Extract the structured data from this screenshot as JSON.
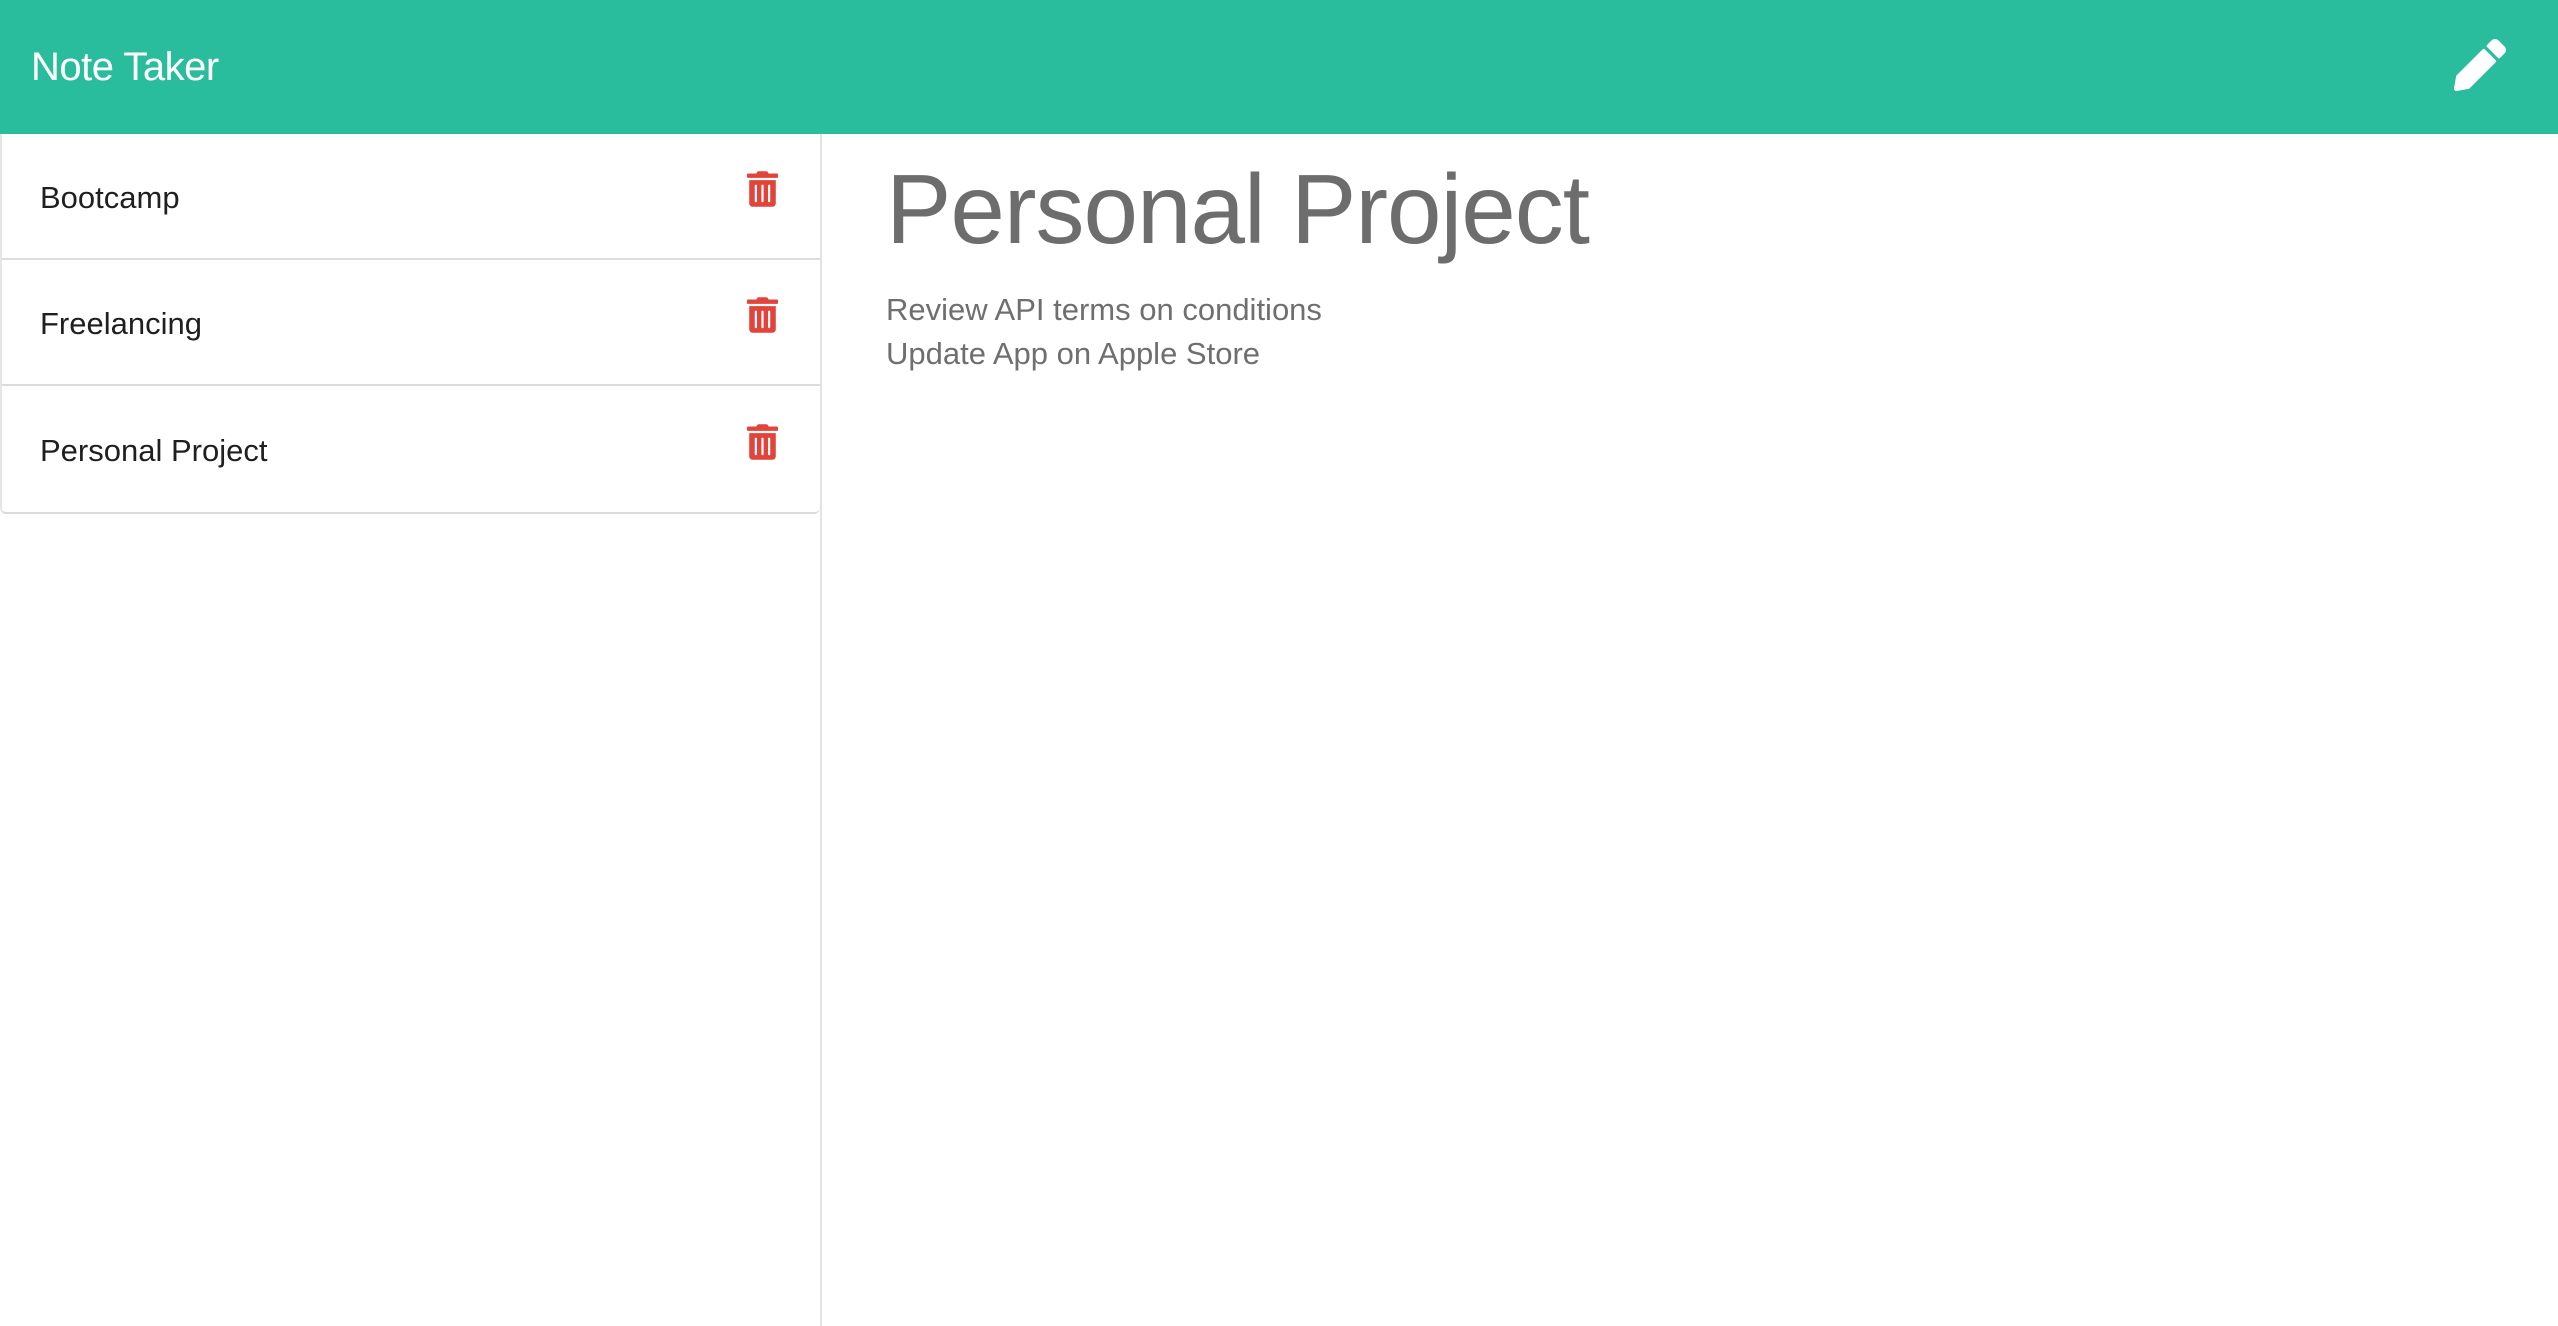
{
  "app": {
    "title": "Note Taker"
  },
  "header": {
    "new_note_icon": "pencil-icon"
  },
  "sidebar": {
    "notes": [
      {
        "title": "Bootcamp",
        "delete_icon": "trash-icon"
      },
      {
        "title": "Freelancing",
        "delete_icon": "trash-icon"
      },
      {
        "title": "Personal Project",
        "delete_icon": "trash-icon"
      }
    ]
  },
  "active_note": {
    "title": "Personal Project",
    "lines": [
      "Review API terms on conditions",
      "Update App on Apple Store"
    ]
  },
  "colors": {
    "navbar": "#2abd9d",
    "delete_icon": "#e0443a",
    "note_text": "#6d6d6d"
  }
}
